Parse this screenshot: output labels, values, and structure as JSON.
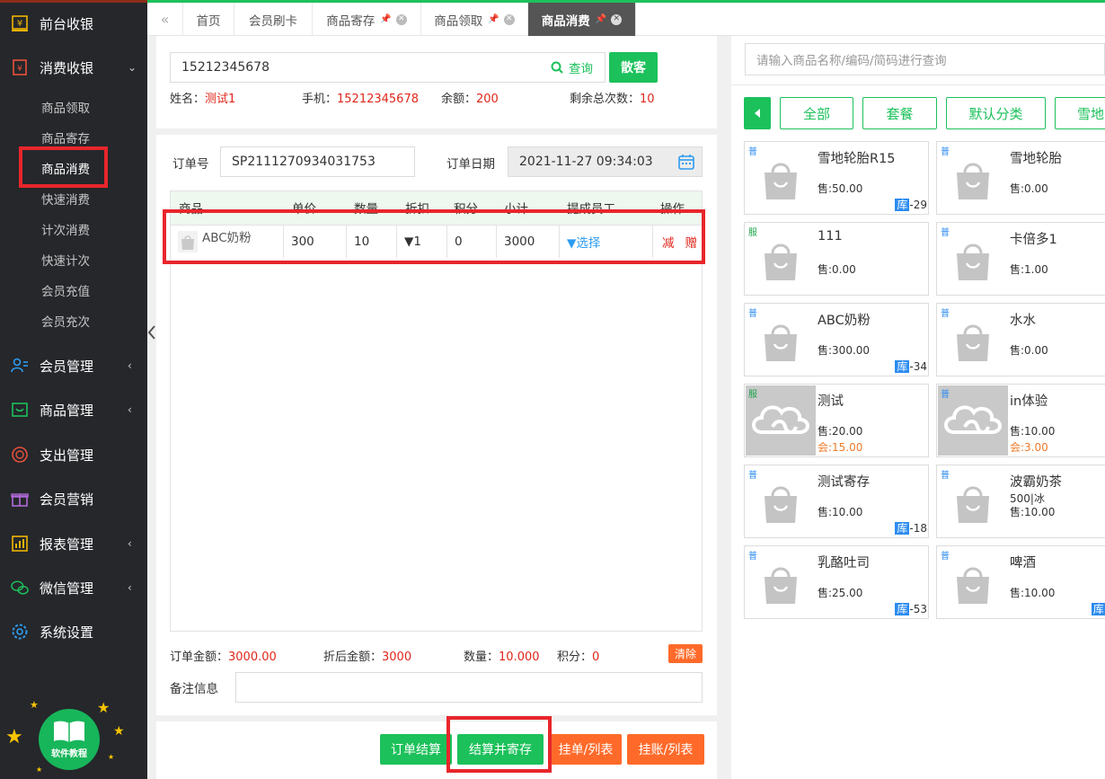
{
  "sidebar": {
    "items": [
      {
        "label": "前台收银"
      },
      {
        "label": "消费收银",
        "chev": "⌄"
      },
      {
        "label": "会员管理",
        "chev": "‹"
      },
      {
        "label": "商品管理",
        "chev": "‹"
      },
      {
        "label": "支出管理"
      },
      {
        "label": "会员营销"
      },
      {
        "label": "报表管理",
        "chev": "‹"
      },
      {
        "label": "微信管理",
        "chev": "‹"
      },
      {
        "label": "系统设置"
      }
    ],
    "sub_items": [
      "商品领取",
      "商品寄存",
      "商品消费",
      "快速消费",
      "计次消费",
      "快速计次",
      "会员充值",
      "会员充次"
    ],
    "tutorial_label": "软件教程"
  },
  "tabs": [
    {
      "label": "首页"
    },
    {
      "label": "会员刷卡"
    },
    {
      "label": "商品寄存"
    },
    {
      "label": "商品领取"
    },
    {
      "label": "商品消费"
    }
  ],
  "member": {
    "search_value": "15212345678",
    "query_label": "查询",
    "walkin_label": "散客",
    "name_label": "姓名：",
    "name_value": "测试1",
    "phone_label": "手机：",
    "phone_value": "15212345678",
    "balance_label": "余额：",
    "balance_value": "200",
    "count_label": "剩余总次数：",
    "count_value": "10"
  },
  "order": {
    "no_label": "订单号",
    "no_value": "SP2111270934031753",
    "date_label": "订单日期",
    "date_value": "2021-11-27 09:34:03"
  },
  "table": {
    "headers": [
      "商品",
      "单价",
      "数量",
      "折扣",
      "积分",
      "小计",
      "提成员工",
      "操作"
    ],
    "row": {
      "product": "ABC奶粉",
      "price": "300",
      "qty": "10",
      "discount": "▼1",
      "points": "0",
      "subtotal": "3000",
      "staff": "▼选择",
      "op_reduce": "减",
      "op_gift": "赠"
    }
  },
  "summary": {
    "order_amount_label": "订单金额：",
    "order_amount": "3000.00",
    "after_discount_label": "折后金额：",
    "after_discount": "3000",
    "qty_label": "数量：",
    "qty": "10.000",
    "points_label": "积分：",
    "points": "0",
    "clear_label": "清除",
    "remark_label": "备注信息"
  },
  "actions": {
    "checkout": "订单结算",
    "checkout_store": "结算并寄存",
    "hang_order": "挂单/列表",
    "hang_account": "挂账/列表"
  },
  "product_search_placeholder": "请输入商品名称/编码/简码进行查询",
  "categories": [
    "全部",
    "套餐",
    "默认分类",
    "雪地"
  ],
  "products": [
    {
      "tag": "普",
      "name": "雪地轮胎R15",
      "price": "售:50.00",
      "stock_k": "库",
      "stock": "-29",
      "image": "bag"
    },
    {
      "tag": "普",
      "name": "雪地轮胎",
      "price": "售:0.00",
      "stock_k": "库",
      "stock": "",
      "image": "bag"
    },
    {
      "tag": "服",
      "name": "111",
      "price": "售:0.00",
      "stock_k": "",
      "stock": "",
      "image": "bag"
    },
    {
      "tag": "普",
      "name": "卡倍多1",
      "price": "售:1.00",
      "stock_k": "库",
      "stock": "",
      "image": "bag"
    },
    {
      "tag": "普",
      "name": "ABC奶粉",
      "price": "售:300.00",
      "stock_k": "库",
      "stock": "-34",
      "image": "bag"
    },
    {
      "tag": "普",
      "name": "水水",
      "price": "售:0.00",
      "stock_k": "库",
      "stock": "",
      "image": "bag"
    },
    {
      "tag": "服",
      "name": "测试",
      "price": "售:20.00",
      "member": "会:15.00",
      "stock_k": "",
      "stock": "",
      "image": "cloud"
    },
    {
      "tag": "普",
      "name": "in体验",
      "price": "售:10.00",
      "member": "会:3.00",
      "stock_k": "库",
      "stock": "",
      "image": "cloud"
    },
    {
      "tag": "普",
      "name": "测试寄存",
      "price": "售:10.00",
      "stock_k": "库",
      "stock": "-18",
      "image": "bag"
    },
    {
      "tag": "普",
      "name": "波霸奶茶",
      "sub": "500|冰",
      "price": "售:10.00",
      "stock_k": "库",
      "stock": "",
      "image": "bag"
    },
    {
      "tag": "普",
      "name": "乳酪吐司",
      "price": "售:25.00",
      "stock_k": "库",
      "stock": "-53",
      "image": "bag"
    },
    {
      "tag": "普",
      "name": "啤酒",
      "price": "售:10.00",
      "stock_k": "库",
      "stock": "99",
      "image": "bag"
    }
  ],
  "colors": {
    "accent": "#1cc15b",
    "orange": "#ff6a2a",
    "sidebar": "#25272b",
    "highlight": "#e8262b",
    "value_red": "#e0261b"
  }
}
